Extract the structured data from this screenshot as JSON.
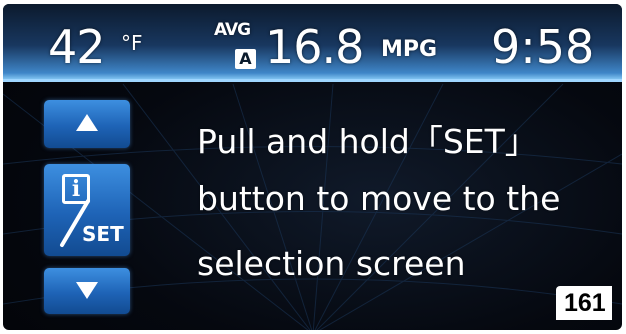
{
  "status_bar": {
    "temperature": "42",
    "temperature_unit": "°F",
    "avg_label": "AVG",
    "avg_badge": "A",
    "fuel_economy": "16.8",
    "fuel_economy_unit": "MPG",
    "clock": "9:58"
  },
  "side_controls": {
    "up_icon": "triangle-up-icon",
    "info_glyph": "i",
    "set_label": "SET",
    "down_icon": "triangle-down-icon"
  },
  "message": {
    "line1": "Pull and hold「SET」",
    "line2": "button to move to the",
    "line3": "selection screen"
  },
  "page_number": "161",
  "colors": {
    "accent_blue": "#1e63b6",
    "status_bar_highlight": "#7fc2f0",
    "text": "#ffffff",
    "background": "#05080f"
  }
}
